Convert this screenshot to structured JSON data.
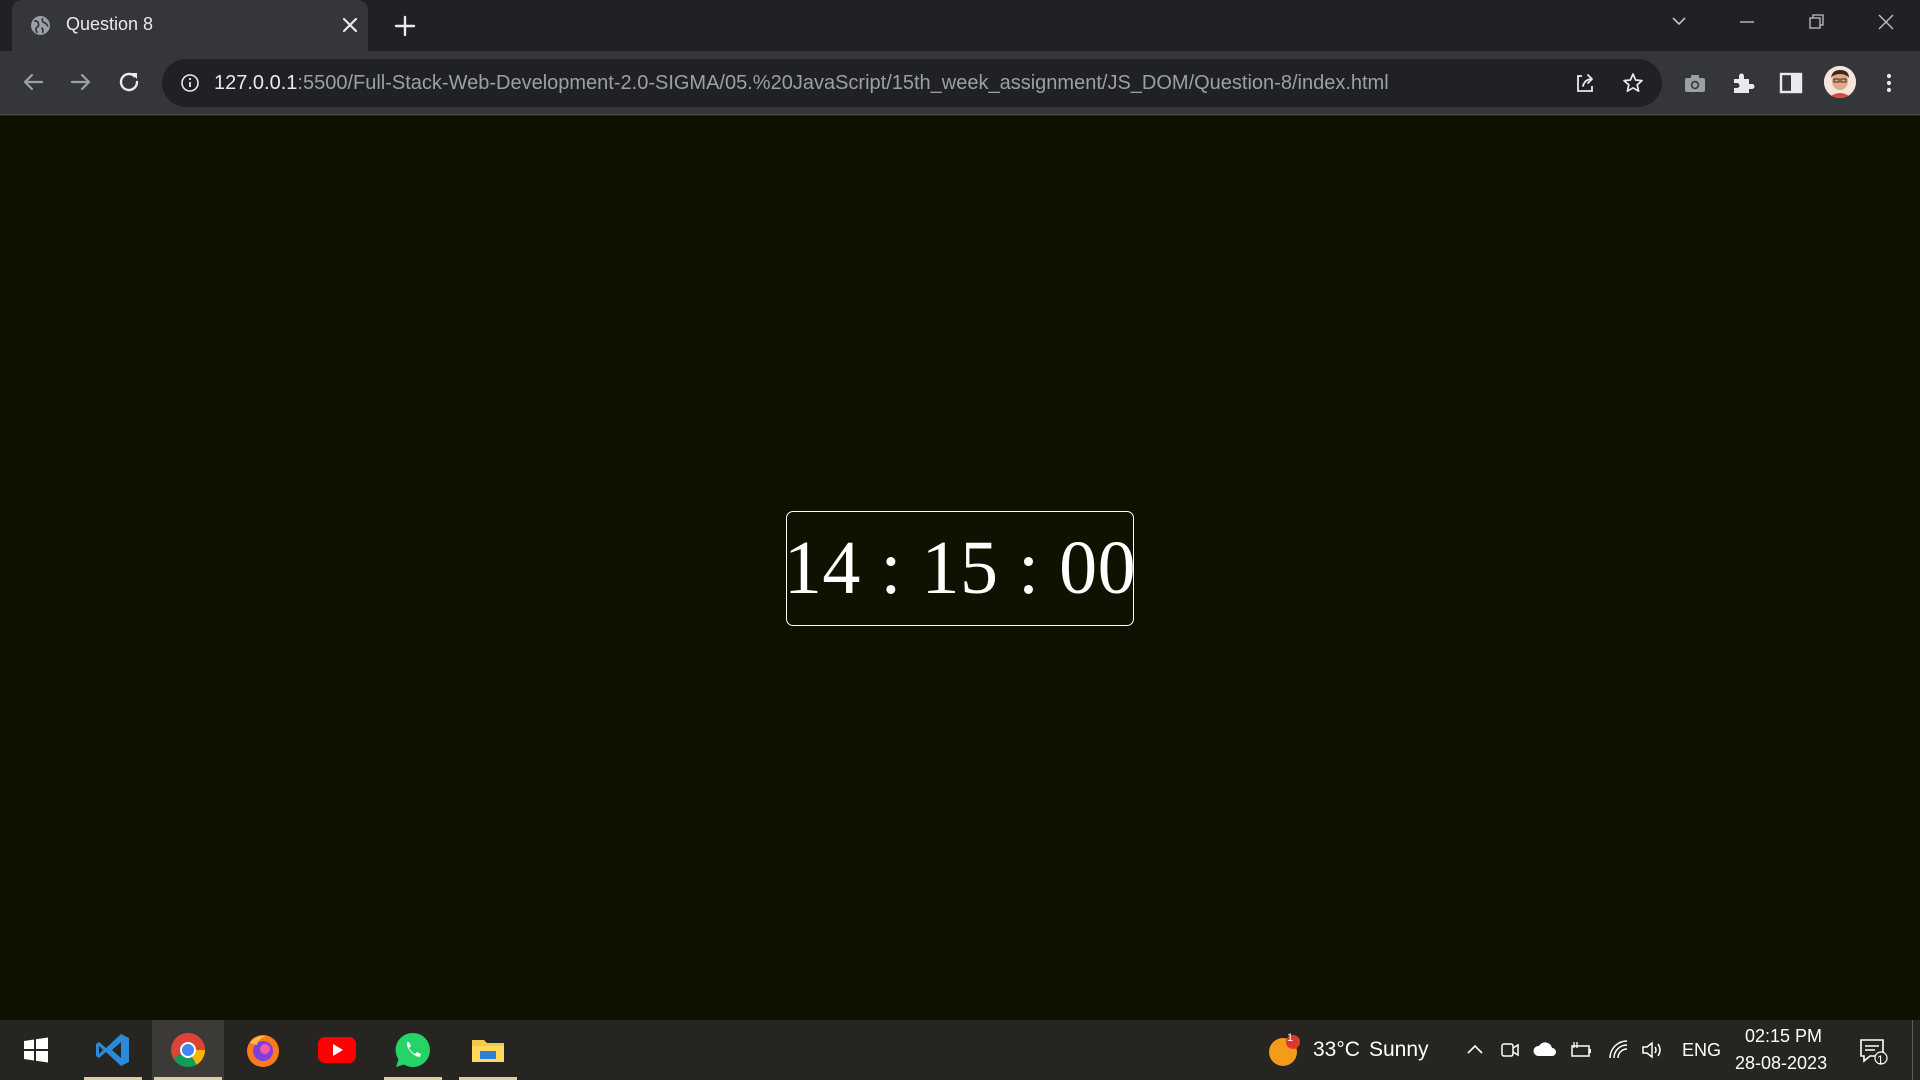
{
  "browser": {
    "tab": {
      "title": "Question 8"
    },
    "address": {
      "host": "127.0.0.1",
      "path": ":5500/Full-Stack-Web-Development-2.0-SIGMA/05.%20JavaScript/15th_week_assignment/JS_DOM/Question-8/index.html"
    },
    "icons": {
      "favicon": "globe-icon",
      "back": "arrow-left-icon",
      "forward": "arrow-right-icon",
      "reload": "reload-icon",
      "share": "share-icon",
      "bookmark": "star-icon",
      "screenshot": "camera-icon",
      "extensions": "puzzle-icon",
      "side_panel": "side-panel-icon",
      "menu": "kebab-menu-icon"
    }
  },
  "page": {
    "clock_display": "14 : 15 : 00"
  },
  "taskbar": {
    "apps": [
      "windows-start",
      "vscode",
      "chrome",
      "firefox",
      "youtube",
      "whatsapp",
      "file-explorer"
    ],
    "weather": {
      "temp": "33°C",
      "condition": "Sunny",
      "badge": "1"
    },
    "language": "ENG",
    "time": "02:15 PM",
    "date": "28-08-2023",
    "notification_count": "1"
  },
  "colors": {
    "page_background": "#111100",
    "tab_active": "#35363a",
    "chrome_frame": "#202124",
    "taskbar": "#262522"
  }
}
